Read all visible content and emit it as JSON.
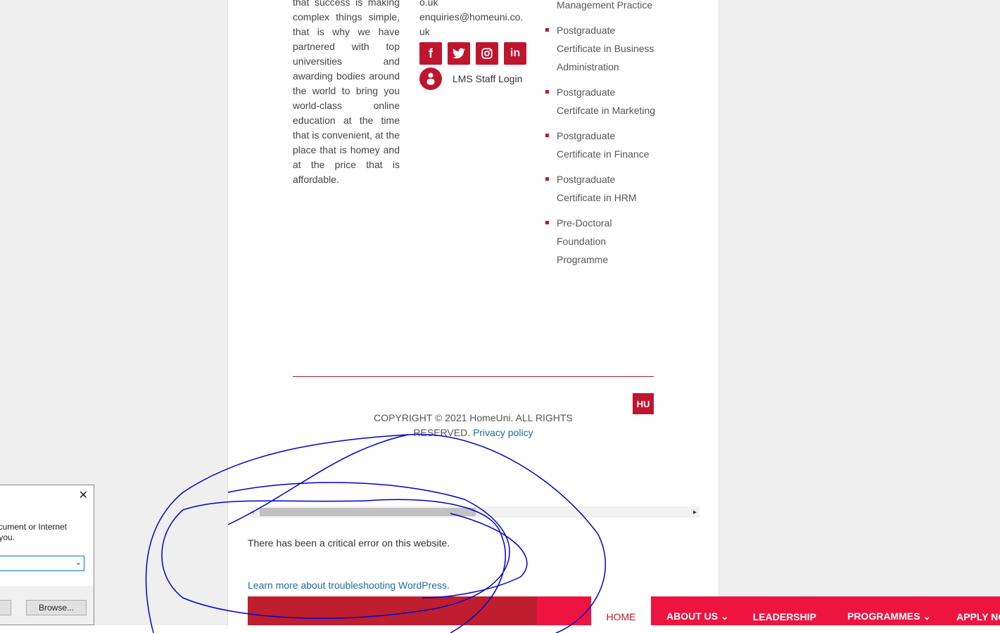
{
  "footer": {
    "about_text": "that success is making complex things simple, that is why we have partnered with top universities and awarding bodies around the world to bring you world-class online education at the time that is convenient, at the place that is homey and at the price that is affordable.",
    "contact_email_part1": "o.uk",
    "contact_email_part2": "enquiries@homeuni.co.",
    "contact_email_part3": "uk",
    "social_icons": [
      "facebook-icon",
      "twitter-icon",
      "instagram-icon",
      "linkedin-icon"
    ],
    "lms_label": "LMS Staff Login",
    "programmes": [
      "Management Practice",
      "Postgraduate Certificate in Business Administration",
      "Postgraduate Certifcate in Marketing",
      "Postgraduate Certificate in Finance",
      "Postgraduate Certificate in HRM",
      "Pre-Doctoral Foundation Programme"
    ],
    "logo_text": "HU",
    "copyright": "COPYRIGHT © 2021 HomeUni. ALL RIGHTS RESERVED.",
    "privacy_link": "Privacy policy"
  },
  "error": {
    "message": "There has been a critical error on this website.",
    "learn_more": "Learn more about troubleshooting WordPress."
  },
  "nav": {
    "home": "HOME",
    "items": [
      "ABOUT US",
      "LEADERSHIP",
      "PROGRAMMES",
      "APPLY NOW"
    ]
  },
  "dialog": {
    "line1": "ocument or Internet",
    "line2": "r you.",
    "browse_label": "Browse..."
  },
  "colors": {
    "brand_red": "#c0152f",
    "nav_pink": "#ed1440",
    "link_blue": "#1a6fa0",
    "annotation_blue": "#0000cc"
  }
}
